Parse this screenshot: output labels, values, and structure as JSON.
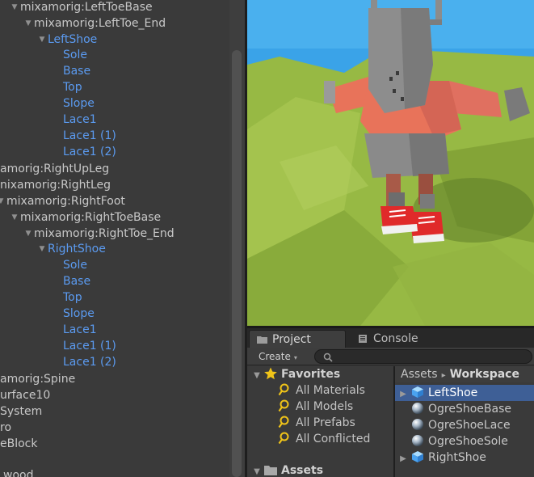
{
  "hierarchy": {
    "rows": [
      {
        "label": "mixamorig:LeftToeBase",
        "arrow": "▼",
        "blue": false
      },
      {
        "label": "mixamorig:LeftToe_End",
        "arrow": "▼",
        "blue": false
      },
      {
        "label": "LeftShoe",
        "arrow": "▼",
        "blue": true
      },
      {
        "label": "Sole",
        "arrow": "",
        "blue": true
      },
      {
        "label": "Base",
        "arrow": "",
        "blue": true
      },
      {
        "label": "Top",
        "arrow": "",
        "blue": true
      },
      {
        "label": "Slope",
        "arrow": "",
        "blue": true
      },
      {
        "label": "Lace1",
        "arrow": "",
        "blue": true
      },
      {
        "label": "Lace1 (1)",
        "arrow": "",
        "blue": true
      },
      {
        "label": "Lace1 (2)",
        "arrow": "",
        "blue": true
      },
      {
        "label": "amorig:RightUpLeg",
        "arrow": "",
        "blue": false
      },
      {
        "label": "nixamorig:RightLeg",
        "arrow": "",
        "blue": false
      },
      {
        "label": "mixamorig:RightFoot",
        "arrow": "▼",
        "blue": false
      },
      {
        "label": "mixamorig:RightToeBase",
        "arrow": "▼",
        "blue": false
      },
      {
        "label": "mixamorig:RightToe_End",
        "arrow": "▼",
        "blue": false
      },
      {
        "label": "RightShoe",
        "arrow": "▼",
        "blue": true
      },
      {
        "label": "Sole",
        "arrow": "",
        "blue": true
      },
      {
        "label": "Base",
        "arrow": "",
        "blue": true
      },
      {
        "label": "Top",
        "arrow": "",
        "blue": true
      },
      {
        "label": "Slope",
        "arrow": "",
        "blue": true
      },
      {
        "label": "Lace1",
        "arrow": "",
        "blue": true
      },
      {
        "label": "Lace1 (1)",
        "arrow": "",
        "blue": true
      },
      {
        "label": "Lace1 (2)",
        "arrow": "",
        "blue": true
      },
      {
        "label": "amorig:Spine",
        "arrow": "",
        "blue": false
      },
      {
        "label": "urface10",
        "arrow": "",
        "blue": false
      },
      {
        "label": "System",
        "arrow": "",
        "blue": false
      },
      {
        "label": "ro",
        "arrow": "",
        "blue": false
      },
      {
        "label": "eBlock",
        "arrow": "",
        "blue": false
      },
      {
        "label": "",
        "arrow": "",
        "blue": false
      },
      {
        "label": "wood",
        "arrow": "",
        "blue": false
      }
    ]
  },
  "tabs": {
    "project": "Project",
    "console": "Console"
  },
  "toolbar": {
    "create_label": "Create",
    "create_caret": "▾",
    "search_placeholder": ""
  },
  "favorites": {
    "header": "Favorites",
    "items": [
      "All Materials",
      "All Models",
      "All Prefabs",
      "All Conflicted"
    ],
    "assets_header": "Assets"
  },
  "assets_panel": {
    "breadcrumb_root": "Assets",
    "breadcrumb_sep": "▸",
    "breadcrumb_current": "Workspace",
    "items": [
      {
        "label": "LeftShoe",
        "kind": "prefab",
        "expandable": true,
        "selected": true
      },
      {
        "label": "OgreShoeBase",
        "kind": "material",
        "expandable": false,
        "selected": false
      },
      {
        "label": "OgreShoeLace",
        "kind": "material",
        "expandable": false,
        "selected": false
      },
      {
        "label": "OgreShoeSole",
        "kind": "material",
        "expandable": false,
        "selected": false
      },
      {
        "label": "RightShoe",
        "kind": "prefab",
        "expandable": true,
        "selected": false
      }
    ]
  },
  "colors": {
    "panel_bg": "#3a3a3a",
    "text": "#c8c8c8",
    "prefab_blue": "#5b9bf1",
    "selection": "#3e5f96",
    "ground_green": "#8fb640",
    "shirt_salmon": "#e8735a",
    "shoe_red": "#e02a2a"
  }
}
